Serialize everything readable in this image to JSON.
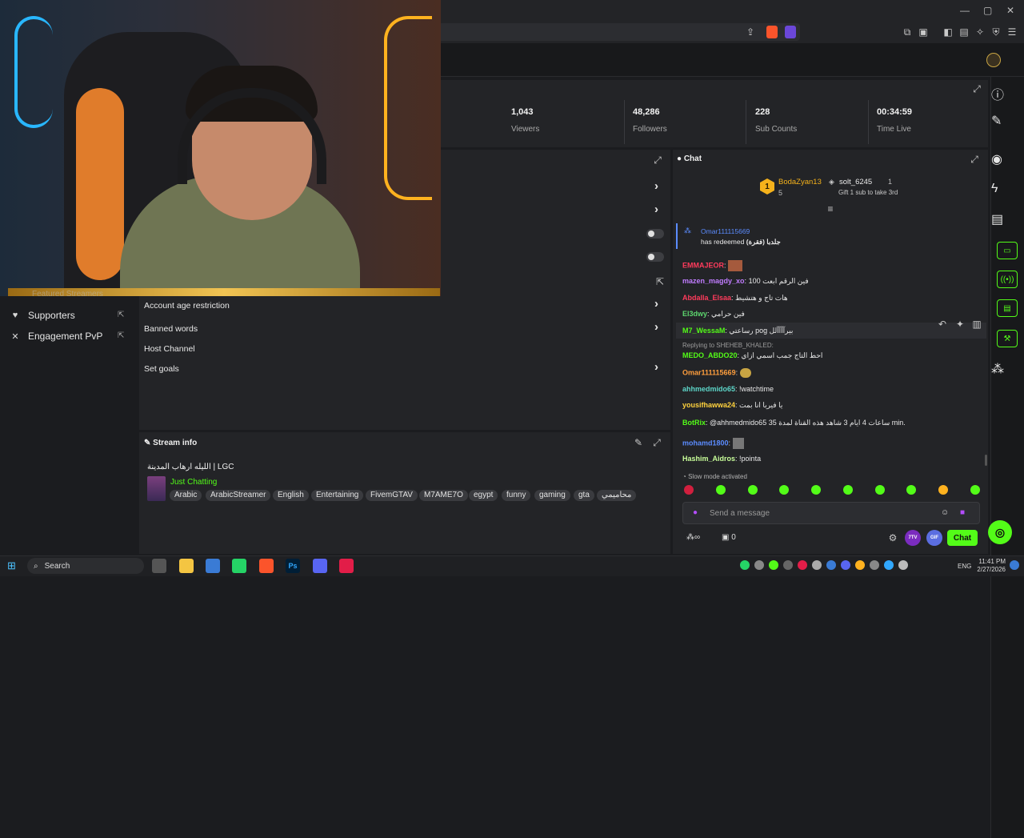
{
  "window": {
    "minimize": "—",
    "maximize": "▢",
    "close": "✕"
  },
  "stats": [
    {
      "value": "1,043",
      "label": "Viewers"
    },
    {
      "value": "48,286",
      "label": "Followers"
    },
    {
      "value": "228",
      "label": "Sub Counts"
    },
    {
      "value": "00:34:59",
      "label": "Time Live"
    }
  ],
  "sidebar": {
    "partial_label": "Featured Streamers",
    "items": [
      {
        "label": "Supporters",
        "icon": "heart-icon"
      },
      {
        "label": "Engagement PvP",
        "icon": "swords-icon"
      }
    ]
  },
  "settings": {
    "items": [
      {
        "label": "Account age restriction"
      },
      {
        "label": "Banned words"
      },
      {
        "label": "Host Channel"
      },
      {
        "label": "Set goals"
      }
    ]
  },
  "stream_info": {
    "header": "Stream info",
    "title": "الليله ارهاب المدينة | LGC",
    "category": "Just Chatting",
    "tags": [
      "Arabic",
      "ArabicStreamer",
      "English",
      "Entertaining",
      "FivemGTAV",
      "M7AME7O",
      "egypt",
      "funny",
      "gaming",
      "gta",
      "محاميمي"
    ]
  },
  "chat": {
    "header": "Chat",
    "leaderboard": {
      "first_name": "BodaZyan13",
      "first_count": "5",
      "second_name": "solt_6245",
      "second_count": "1",
      "second_rank": "1",
      "gift_text": "Gift 1 sub to take 3rd"
    },
    "redeem": {
      "user": "Omar111115669",
      "text": "has redeemed",
      "reward": "(فقرة) جلدبا"
    },
    "messages": [
      {
        "user": "EMMAJEOR",
        "color": "#ff3b5c",
        "text": ""
      },
      {
        "user": "mazen_magdy_xo",
        "color": "#c07cff",
        "text": "فين الرقم ابعت 100"
      },
      {
        "user": "Abdalla_Elsaa",
        "color": "#ff3b5c",
        "text": "هات تاج و هتشيط"
      },
      {
        "user": "El3dwy",
        "color": "#5dd66e",
        "text": "فين حرامي"
      },
      {
        "user": "M7_WessaM",
        "color": "#53fc18",
        "text": "رساعتي pog بيرآآآآلل"
      },
      {
        "reply": "Replying to SHEHEB_KHALED:"
      },
      {
        "user": "MEDO_ABDO20",
        "color": "#53fc18",
        "text": "احط التاج جمب اسمي ازاي"
      },
      {
        "user": "Omar111115669",
        "color": "#ff9e3d",
        "text": ""
      },
      {
        "user": "ahhmedmido65",
        "color": "#5dd6c9",
        "text": "!watchtime"
      },
      {
        "user": "yousifhawwa24",
        "color": "#ffd23d",
        "text": "يا فيربا انا بمت"
      },
      {
        "user": "BotRix",
        "color": "#53fc18",
        "text": "@ahhmedmido65 35 ساعات 4 ايام 3 شاهد هذه القناة لمدة min."
      },
      {
        "user": "mohamd1800",
        "color": "#5b8cff",
        "text": ""
      },
      {
        "user": "Hashim_Aidros",
        "color": "#c9ff9a",
        "text": "!pointa"
      }
    ],
    "slow_mode": "Slow mode activated",
    "input_placeholder": "Send a message",
    "points": "0",
    "chat_button": "Chat",
    "badge_7tv": "7TV",
    "badge_gif": "GIF"
  },
  "taskbar": {
    "search": "Search",
    "lang": "ENG",
    "time": "11:41 PM",
    "date": "2/27/2026"
  },
  "colors": {
    "accent": "#53fc18",
    "bg": "#1b1c1f",
    "panel": "#232427"
  }
}
